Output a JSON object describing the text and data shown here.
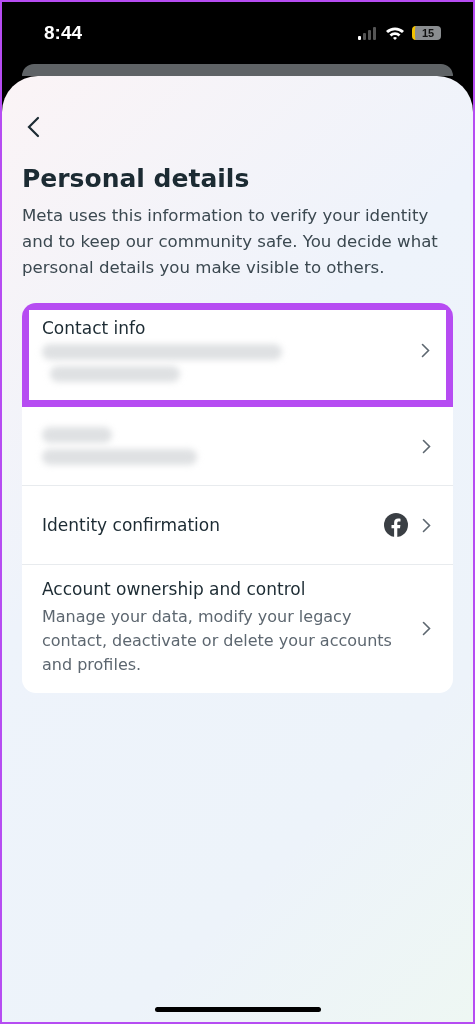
{
  "status_bar": {
    "time": "8:44",
    "battery": "15"
  },
  "header": {
    "title": "Personal details",
    "description": "Meta uses this information to verify your identity and to keep our community safe. You decide what personal details you make visible to others."
  },
  "items": [
    {
      "kind": "redacted_detail",
      "title": "Contact info",
      "highlighted": true
    },
    {
      "kind": "redacted_all",
      "highlighted": false
    },
    {
      "kind": "facebook",
      "title": "Identity confirmation",
      "highlighted": false
    },
    {
      "kind": "plain",
      "title": "Account ownership and control",
      "description": "Manage your data, modify your legacy contact, deactivate or delete your accounts and profiles.",
      "highlighted": false
    }
  ]
}
